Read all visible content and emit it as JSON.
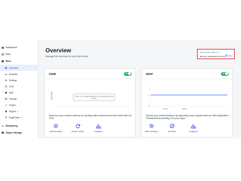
{
  "sidebar": {
    "items": [
      {
        "label": "Dashboard",
        "icon": "home-icon"
      },
      {
        "label": "DNS",
        "icon": "globe-icon"
      },
      {
        "label": "Sites",
        "icon": "sites-icon"
      },
      {
        "label": "Overview",
        "icon": "grid-icon"
      },
      {
        "label": "Analytics",
        "icon": "chart-icon"
      },
      {
        "label": "Settings",
        "icon": "gear-icon"
      },
      {
        "label": "CDN",
        "icon": "cdn-icon"
      },
      {
        "label": "WAF",
        "icon": "shield-icon"
      },
      {
        "label": "Firewall",
        "icon": "firewall-icon"
      },
      {
        "label": "Scripts",
        "icon": "code-icon"
      },
      {
        "label": "Origins",
        "icon": "origin-icon"
      },
      {
        "label": "EdgeRules",
        "icon": "rules-icon"
      },
      {
        "label": "Monitoring",
        "icon": "monitor-icon"
      },
      {
        "label": "Object Storage",
        "icon": "storage-icon"
      }
    ]
  },
  "page": {
    "title": "Overview",
    "subtitle": "Manage the services for your site below."
  },
  "edge_address": {
    "label": "Select Edge Address ⓘ",
    "value": "l3hxxw.r.stackpathcdn.com",
    "copy_label": "Copy"
  },
  "cdn": {
    "title": "CDN",
    "toggle_label": "ON",
    "toggle_on": true,
    "ylabel": "Bandwidth",
    "no_data": "There is no data available for the selected time period",
    "description": "Speed up your content delivery by caching static content around the world with our CDN.",
    "actions": [
      {
        "label": "CDN Settings",
        "icon": "gear-icon"
      },
      {
        "label": "Purge Cache",
        "icon": "refresh-icon"
      },
      {
        "label": "Analytics",
        "icon": "bar-chart-icon"
      }
    ]
  },
  "waf": {
    "title": "WAF",
    "toggle_label": "ON",
    "toggle_on": true,
    "y_ticks": [
      "1",
      "0"
    ],
    "x_ticks": [
      "23:00",
      "00:00"
    ],
    "description": "Secure your content delivery by inspecting every request with our Web Application Firewall before sending it to your origin.",
    "actions": [
      {
        "label": "WAF Settings",
        "icon": "gear-icon"
      },
      {
        "label": "IP Rules",
        "icon": "ip-rules-icon"
      },
      {
        "label": "Analytics",
        "icon": "bar-chart-icon"
      }
    ]
  },
  "colors": {
    "accent": "#2f54eb",
    "toggle_on": "#16a34a",
    "highlight_border": "#e23c3c"
  }
}
